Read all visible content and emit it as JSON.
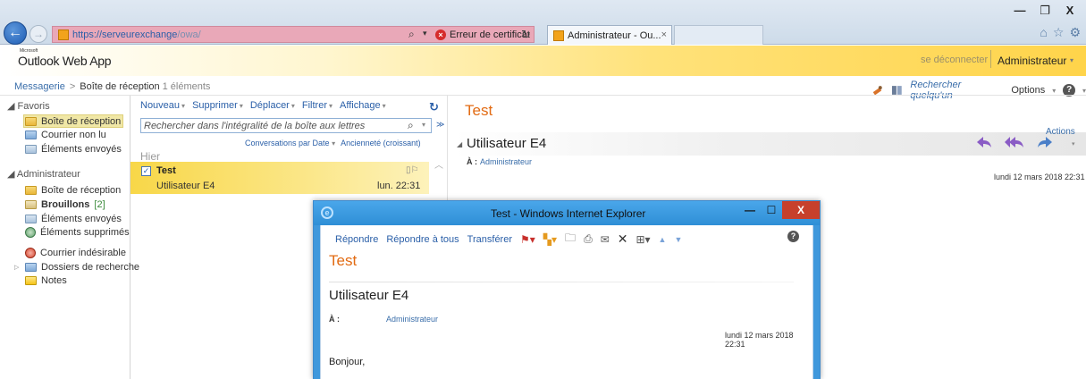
{
  "browser": {
    "url_host": "https://serveurexchange",
    "url_path": "/owa/",
    "cert_error": "Erreur de certificat",
    "tab_title": "Administrateur - Ou...",
    "controls": {
      "minimize": "—",
      "maximize": "❐",
      "close": "X"
    }
  },
  "owa": {
    "brand_small": "Microsoft",
    "brand": "Outlook Web App",
    "signout": "se déconnecter",
    "user": "Administrateur",
    "breadcrumb_root": "Messagerie",
    "breadcrumb_current": "Boîte de réception",
    "breadcrumb_count": "1 éléments",
    "find_someone": "Rechercher quelqu'un",
    "options": "Options"
  },
  "nav": {
    "favorites_label": "Favoris",
    "favorites": [
      {
        "label": "Boîte de réception",
        "icon": "inbox-folder-icon"
      },
      {
        "label": "Courrier non lu",
        "icon": "unread-mail-icon"
      },
      {
        "label": "Éléments envoyés",
        "icon": "sent-items-icon"
      }
    ],
    "mailbox_label": "Administrateur",
    "mailbox": [
      {
        "label": "Boîte de réception"
      },
      {
        "label": "Brouillons",
        "count": "[2]"
      },
      {
        "label": "Éléments envoyés"
      },
      {
        "label": "Éléments supprimés"
      },
      {
        "label": "Courrier indésirable"
      },
      {
        "label": "Dossiers de recherche"
      },
      {
        "label": "Notes"
      }
    ]
  },
  "list": {
    "toolbar": {
      "new": "Nouveau",
      "delete": "Supprimer",
      "move": "Déplacer",
      "filter": "Filtrer",
      "view": "Affichage"
    },
    "search_placeholder": "Rechercher dans l'intégralité de la boîte aux lettres",
    "sort_by": "Conversations par Date",
    "sort_order": "Ancienneté (croissant)",
    "group_header": "Hier",
    "messages": [
      {
        "subject": "Test",
        "from": "Utilisateur E4",
        "time": "lun. 22:31"
      }
    ]
  },
  "reading": {
    "subject": "Test",
    "sender": "Utilisateur E4",
    "to_label": "À :",
    "to": "Administrateur",
    "actions": "Actions",
    "date": "lundi 12 mars 2018 22:31"
  },
  "popup": {
    "title": "Test - Windows Internet Explorer",
    "reply": "Répondre",
    "reply_all": "Répondre à tous",
    "forward": "Transférer",
    "subject": "Test",
    "sender": "Utilisateur E4",
    "to_label": "À :",
    "to": "Administrateur",
    "date": "lundi 12 mars 2018 22:31",
    "body": "Bonjour,"
  },
  "colors": {
    "accent_orange": "#e26b13",
    "link_blue": "#2a5fa8",
    "selection_yellow": "#f8d748"
  }
}
